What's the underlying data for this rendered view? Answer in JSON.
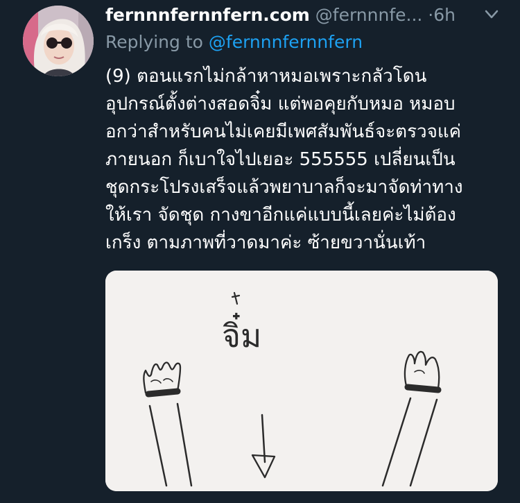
{
  "tweet": {
    "display_name": "fernnnfernnfern.com",
    "handle": "@fernnnfe...",
    "separator": "·",
    "time": "6h",
    "reply_prefix": "Replying to",
    "reply_handle": "@fernnnfernnfern",
    "body_lines": [
      "(9) ตอนแรกไม่กล้าหาหมอเพราะกลัวโดน",
      "อุปกรณ์ตั้งต่างสอดจิ๋ม แต่พอคุยกับหมอ หมอบ",
      "อกว่าสำหรับคนไม่เคยมีเพศสัมพันธ์จะตรวจแค่",
      "ภายนอก ก็เบาใจไปเยอะ 555555 เปลี่ยนเป็น",
      "ชุดกระโปรงเสร็จแล้วพยาบาลก็จะมาจัดท่าทาง",
      "ให้เรา จัดชุด กางขาอีกแค่แบบนี้เลยค่ะไม่ต้อง",
      "เกร็ง ตามภาพที่วาดมาค่ะ ซ้ายขวานั่นเท้า"
    ],
    "media": {
      "drawing_label": "จิ๋ม"
    }
  },
  "colors": {
    "background": "#15202b",
    "text_primary": "#ffffff",
    "text_secondary": "#8899a6",
    "link": "#1da1f2"
  },
  "icons": {
    "avatar": "avatar",
    "chevron": "chevron-down-icon"
  }
}
